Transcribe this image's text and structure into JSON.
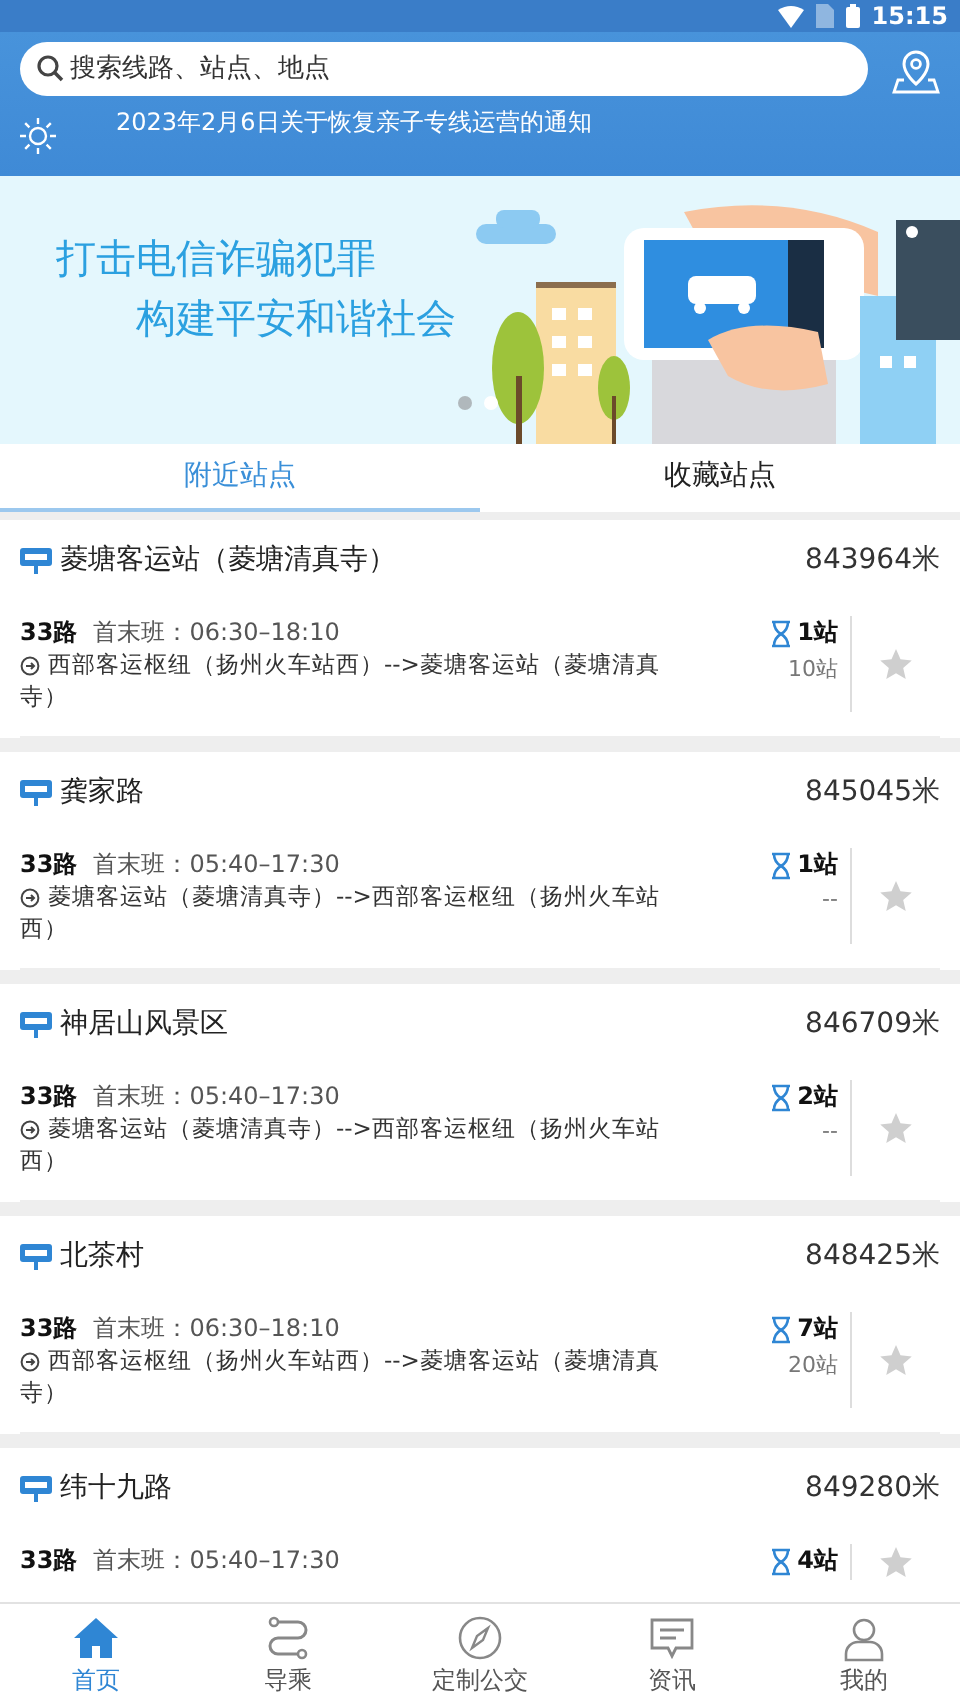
{
  "status_bar": {
    "time": "15:15"
  },
  "search": {
    "placeholder": "搜索线路、站点、地点"
  },
  "notice": {
    "text": "2023年2月6日关于恢复亲子专线运营的通知"
  },
  "banner": {
    "lines": [
      "打击电信诈骗犯罪",
      "构建平安和谐社会"
    ],
    "dots": [
      {
        "selected": false
      },
      {
        "selected": true
      }
    ]
  },
  "tabs": [
    {
      "label": "附近站点",
      "selected": true
    },
    {
      "label": "收藏站点",
      "selected": false
    }
  ],
  "stops": [
    {
      "name": "菱塘客运站（菱塘清真寺）",
      "distance": "843964米",
      "line": "33路",
      "schedule": "首末班：06:30–18:10",
      "route": "西部客运枢纽（扬州火车站西）-->菱塘客运站（菱塘清真寺）",
      "stops_away": "1站",
      "next_bus": "10站",
      "favorited": false
    },
    {
      "name": "龚家路",
      "distance": "845045米",
      "line": "33路",
      "schedule": "首末班：05:40–17:30",
      "route": "菱塘客运站（菱塘清真寺）-->西部客运枢纽（扬州火车站西）",
      "stops_away": "1站",
      "next_bus": "--",
      "favorited": false
    },
    {
      "name": "神居山风景区",
      "distance": "846709米",
      "line": "33路",
      "schedule": "首末班：05:40–17:30",
      "route": "菱塘客运站（菱塘清真寺）-->西部客运枢纽（扬州火车站西）",
      "stops_away": "2站",
      "next_bus": "--",
      "favorited": false
    },
    {
      "name": "北茶村",
      "distance": "848425米",
      "line": "33路",
      "schedule": "首末班：06:30–18:10",
      "route": "西部客运枢纽（扬州火车站西）-->菱塘客运站（菱塘清真寺）",
      "stops_away": "7站",
      "next_bus": "20站",
      "favorited": false
    },
    {
      "name": "纬十九路",
      "distance": "849280米",
      "line": "33路",
      "schedule": "首末班：05:40–17:30",
      "stops_away": "4站",
      "favorited": false
    }
  ],
  "bottom_nav": [
    {
      "label": "首页",
      "selected": true
    },
    {
      "label": "导乘",
      "selected": false
    },
    {
      "label": "定制公交",
      "selected": false
    },
    {
      "label": "资讯",
      "selected": false
    },
    {
      "label": "我的",
      "selected": false
    }
  ]
}
